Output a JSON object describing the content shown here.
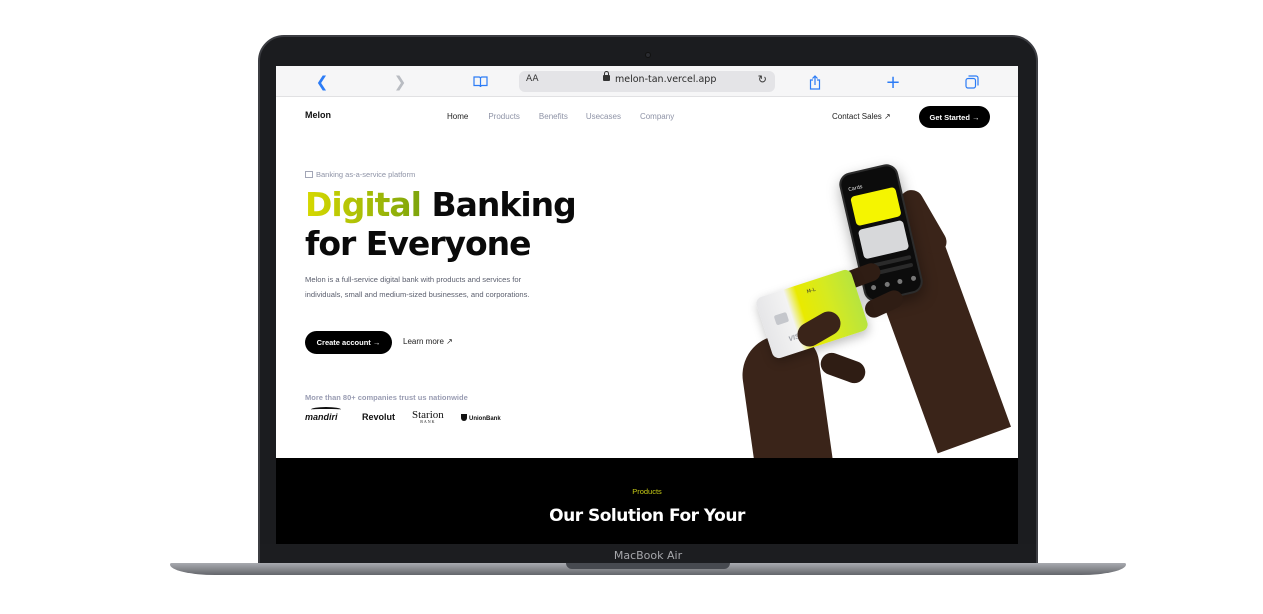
{
  "device": {
    "label": "MacBook Air"
  },
  "browser": {
    "text_size_label": "AA",
    "url": "melon-tan.vercel.app",
    "icons": [
      "back-icon",
      "forward-icon",
      "book-icon",
      "lock-icon",
      "reload-icon",
      "share-icon",
      "new-tab-icon",
      "tabs-icon"
    ],
    "accent_color": "#2c7cf6"
  },
  "site": {
    "logo": "Melon",
    "nav": [
      {
        "label": "Home",
        "active": true
      },
      {
        "label": "Products",
        "active": false
      },
      {
        "label": "Benefits",
        "active": false
      },
      {
        "label": "Usecases",
        "active": false
      },
      {
        "label": "Company",
        "active": false
      }
    ],
    "contact_label": "Contact Sales ↗",
    "get_started_label": "Get Started →"
  },
  "hero": {
    "eyebrow": "Banking as-a-service platform",
    "title_accent": "Digital",
    "title_rest": " Banking",
    "title_line2": "for Everyone",
    "description": "Melon is a full-service digital bank with products and services for individuals, small and medium-sized businesses, and corporations.",
    "primary_cta": "Create account →",
    "secondary_cta": "Learn more ↗",
    "trust_text": "More than 80+ companies trust us nationwide",
    "partners": {
      "mandiri": "mandiri",
      "revolut": "Revolut",
      "starion": "Starion",
      "starion_sub": "BANK",
      "unionbank": "UnionBank"
    },
    "accent_gradient": [
      "#d7d900",
      "#7da40c"
    ]
  },
  "products": {
    "eyebrow": "Products",
    "heading": "Our Solution For Your"
  }
}
